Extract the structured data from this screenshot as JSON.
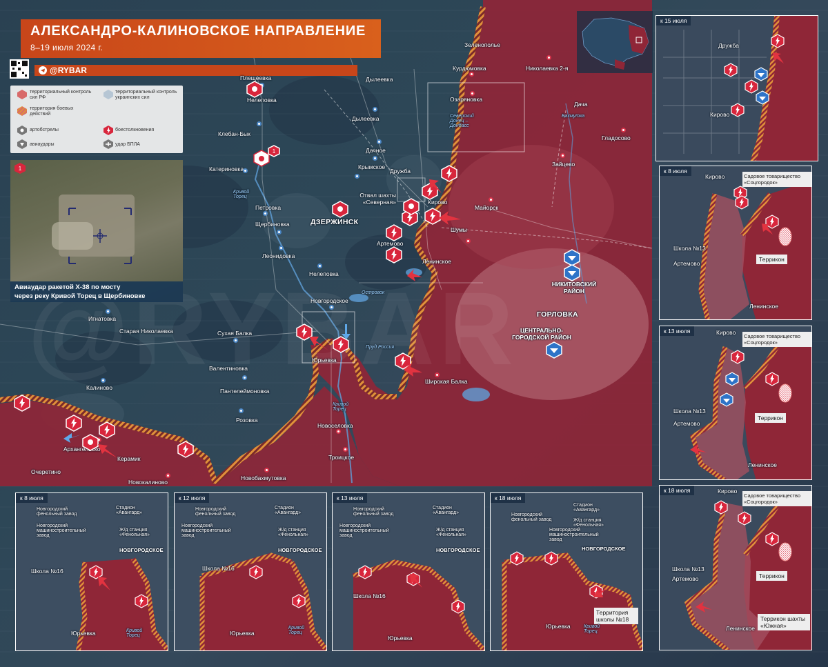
{
  "header": {
    "title": "АЛЕКСАНДРО-КАЛИНОВСКОЕ НАПРАВЛЕНИЕ",
    "subtitle": "8–19 июля 2024 г.",
    "brand": "@RYBAR"
  },
  "legend": {
    "ru_control": "территориальный контроль сил РФ",
    "ua_control": "территориальный контроль украинских сил",
    "combat": "территория боевых действий",
    "artillery": "артобстрелы",
    "clashes": "боестолкновения",
    "airstrikes": "авиаудары",
    "drone": "удар БПЛА"
  },
  "photo": {
    "marker": "1",
    "caption_line1": "Авиаудар ракетой Х-38 по мосту",
    "caption_line2": "через реку Кривой Торец в Щербиновке"
  },
  "map_labels": {
    "pleshcheevka": "Плещеевка",
    "nelepovka_top": "Нелеповка",
    "kleban_byk": "Клебан-Бык",
    "katerinovka": "Катериновка",
    "petrovka": "Петровка",
    "shcherbinovka": "Щербиновка",
    "leonidovka": "Леонидовка",
    "nelepovka": "Нелеповка",
    "novgorodskoe": "Новгородское",
    "ignatovka": "Игнатовка",
    "staraya_nikolaevka": "Старая Николаевка",
    "sukhaya_balka": "Сухая Балка",
    "valentinovka": "Валентиновка",
    "panteleimonovka": "Пантелеймоновка",
    "rozovka": "Розовка",
    "kalinovo": "Калиново",
    "arkhangelskoe": "Архангельское",
    "keramik": "Керамик",
    "novokalinovo": "Новокалиново",
    "ocheretino": "Очеретино",
    "novobakhmutovka": "Новобахмутовка",
    "novoselovka": "Новоселовка",
    "troitskoe": "Троицкое",
    "yurievka": "Юрьевка",
    "shirokaya_balka": "Широкая Балка",
    "dzerzhinsk": "ДЗЕРЖИНСК",
    "artemovo": "Артемово",
    "leninskoe": "Ленинское",
    "shumy": "Шумы",
    "kirovo": "Кирово",
    "mayorsk": "Майорск",
    "druzhba": "Дружба",
    "krymskoe": "Крымское",
    "dachnoe": "Дачное",
    "dyleevka": "Дылеевка",
    "dyleevka2": "Дылеевка",
    "ozaryanovka": "Озаряновка",
    "kurdyumovka": "Курдюмовка",
    "zelenopole": "Зеленополье",
    "nikolaevka2": "Николаевка 2-я",
    "dacha": "Дача",
    "zaitsevo": "Зайцево",
    "gladosovo": "Гладосово",
    "gorlovka": "ГОРЛОВКА",
    "nikitovsky": "НИКИТОВСКИЙ РАЙОН",
    "central": "ЦЕНТРАЛЬНО-ГОРОДСКОЙ РАЙОН",
    "otval": "Отвал шахты «Северная»",
    "krivoy_torets": "Кривой Торец",
    "krivoy_torets2": "Кривой Торец",
    "seversky_donets": "Северский Донец – Донбасс",
    "bakhmutka": "Бахмутка",
    "prud_rossiya": "Пруд Россия",
    "ostrovok": "Островок"
  },
  "insets": {
    "jul15": {
      "date": "к 15 июля",
      "druzhba": "Дружба",
      "kirovo": "Кирово"
    },
    "jul8r": {
      "date": "к 8 июля",
      "kirovo": "Кирово",
      "sad": "Садовое товарищество «Соцгородок»",
      "school": "Школа №13",
      "artemovo": "Артемово",
      "terrikon": "Террикон",
      "leninskoe": "Ленинское"
    },
    "jul13r": {
      "date": "к 13 июля",
      "kirovo": "Кирово",
      "sad": "Садовое товарищество «Соцгородок»",
      "school": "Школа №13",
      "artemovo": "Артемово",
      "terrikon": "Террикон",
      "leninskoe": "Ленинское"
    },
    "jul18r": {
      "date": "к 18 июля",
      "kirovo": "Кирово",
      "sad": "Садовое товарищество «Соцгородок»",
      "school": "Школа №13",
      "artemovo": "Артемово",
      "terrikon": "Террикон",
      "terrikon2": "Террикон шахты «Южная»",
      "leninskoe": "Ленинское"
    },
    "b8": {
      "date": "к 8 июля",
      "plant": "Новгородский фенольный завод",
      "stadium": "Стадион «Авангард»",
      "mash": "Новгородский машиностроительный завод",
      "station": "Ж/д станция «Фенольная»",
      "novg": "НОВГОРОДСКОЕ",
      "school": "Школа №16",
      "yur": "Юрьевка",
      "river": "Кривой Торец"
    },
    "b12": {
      "date": "к 12 июля",
      "plant": "Новгородский фенольный завод",
      "stadium": "Стадион «Авангард»",
      "mash": "Новгородский машиностроительный завод",
      "station": "Ж/д станция «Фенольная»",
      "novg": "НОВГОРОДСКОЕ",
      "school": "Школа №16",
      "yur": "Юрьевка",
      "river": "Кривой Торец"
    },
    "b13": {
      "date": "к 13 июля",
      "plant": "Новгородский фенольный завод",
      "stadium": "Стадион «Авангард»",
      "mash": "Новгородский машиностроительный завод",
      "station": "Ж/д станция «Фенольная»",
      "novg": "НОВГОРОДСКОЕ",
      "school": "Школа №16",
      "yur": "Юрьевка"
    },
    "b18": {
      "date": "к 18 июля",
      "plant": "Новгородский фенольный завод",
      "stadium": "Стадион «Авангард»",
      "mash": "Новгородский машиностроительный завод",
      "station": "Ж/д станция «Фенольная»",
      "novg": "НОВГОРОДСКОЕ",
      "school": "Территория школы №18",
      "yur": "Юрьевка",
      "river": "Кривой Торец"
    }
  },
  "colors": {
    "ru_zone": "#9c2a3a",
    "combat_stripe": "#e0913a",
    "ua_icon": "#2e74c8",
    "clash_icon": "#d8263c",
    "title_bg": "#d0501c"
  }
}
